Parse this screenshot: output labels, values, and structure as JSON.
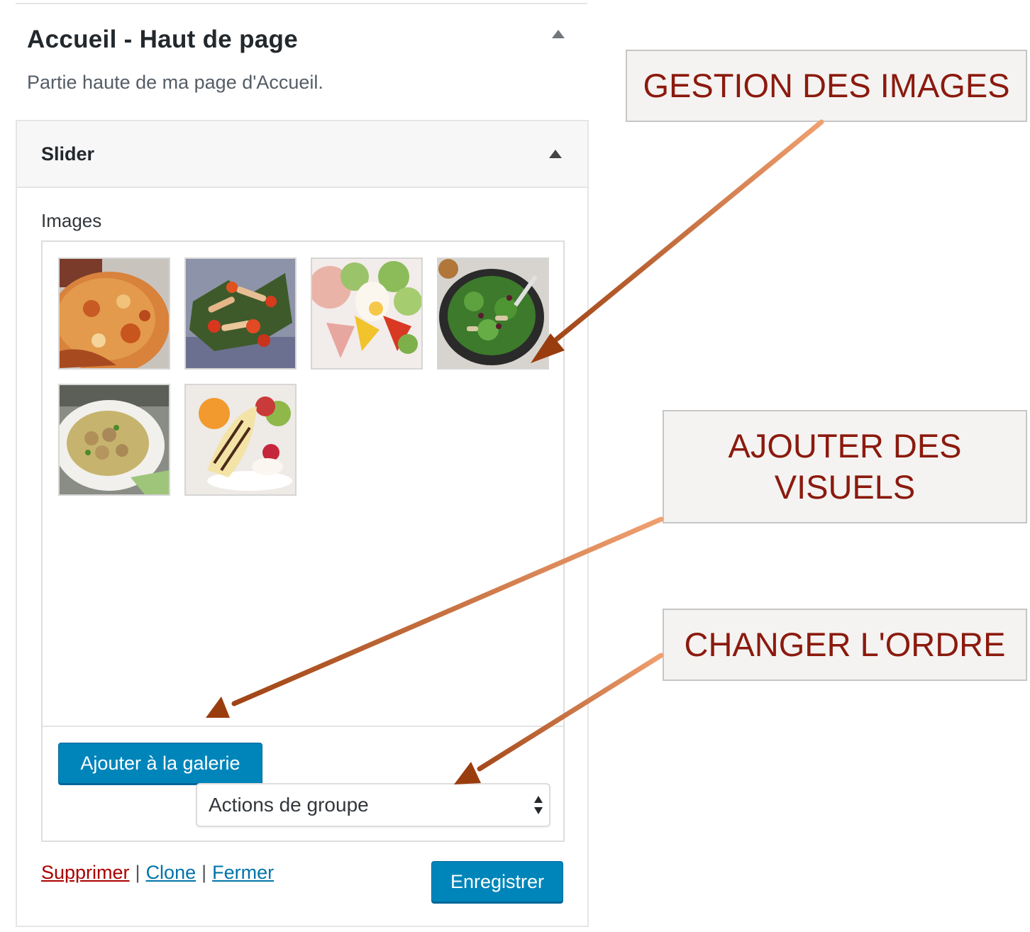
{
  "widget": {
    "title": "Accueil - Haut de page",
    "description": "Partie haute de ma page d'Accueil."
  },
  "section": {
    "title": "Slider",
    "field_label": "Images"
  },
  "gallery": {
    "images": [
      {
        "subject": "pizza"
      },
      {
        "subject": "roasted vegetables"
      },
      {
        "subject": "salad with egg"
      },
      {
        "subject": "green salad in pan"
      },
      {
        "subject": "soup with meatballs"
      },
      {
        "subject": "banana dessert"
      }
    ],
    "add_button_label": "Ajouter à la galerie",
    "bulk_actions": {
      "selected": "Actions de groupe"
    }
  },
  "footer": {
    "delete_label": "Supprimer",
    "clone_label": "Clone",
    "close_label": "Fermer",
    "separator": "|",
    "save_label": "Enregistrer"
  },
  "callouts": {
    "manage_images": "GESTION DES IMAGES",
    "add_visuals_line1": "AJOUTER DES",
    "add_visuals_line2": "VISUELS",
    "change_order": "CHANGER L'ORDRE"
  },
  "colors": {
    "primary_button": "#0085ba",
    "delete_link": "#aa0000",
    "link": "#0073aa",
    "callout_text": "#8b1a0e",
    "arrow": "#c65a1e"
  }
}
